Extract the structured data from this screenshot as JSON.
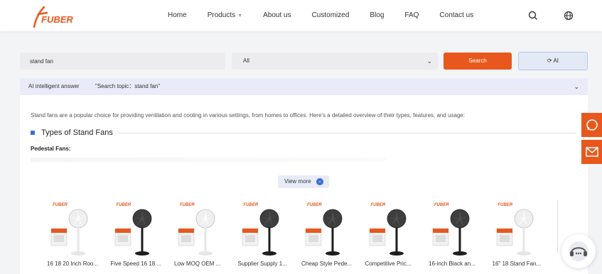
{
  "brand": {
    "logo_text": "FUBER",
    "accent": "#e8581c"
  },
  "nav": {
    "items": [
      "Home",
      "Products",
      "About us",
      "Customized",
      "Blog",
      "FAQ",
      "Contact us"
    ],
    "icons": [
      "search-icon",
      "globe-icon"
    ]
  },
  "search": {
    "query": "stand fan",
    "category": "All",
    "search_label": "Search",
    "ai_label": "AI"
  },
  "ai_panel": {
    "header_label": "AI intelligent answer",
    "topic": "\"Search topic：stand fan\"",
    "intro": "Stand fans are a popular choice for providing ventilation and cooling in various settings, from homes to offices. Here's a detailed overview of their types, features, and usage:",
    "section_title": "Types of Stand Fans",
    "subhead": "Pedestal Fans:",
    "view_more": "View more"
  },
  "products": [
    {
      "name": "16 18 20 Inch Roo...",
      "color": "white"
    },
    {
      "name": "Five Speed 16 18 ...",
      "color": "black"
    },
    {
      "name": "Low MOQ OEM ...",
      "color": "white"
    },
    {
      "name": "Supplier Supply 1...",
      "color": "black"
    },
    {
      "name": "Cheap Style Pede...",
      "color": "black"
    },
    {
      "name": "Competitive Pric...",
      "color": "black"
    },
    {
      "name": "16-inch Black an...",
      "color": "black"
    },
    {
      "name": "16\" 18 Stand Fan...",
      "color": "white"
    }
  ],
  "floating": [
    "whatsapp-icon",
    "email-icon",
    "chat-icon"
  ]
}
